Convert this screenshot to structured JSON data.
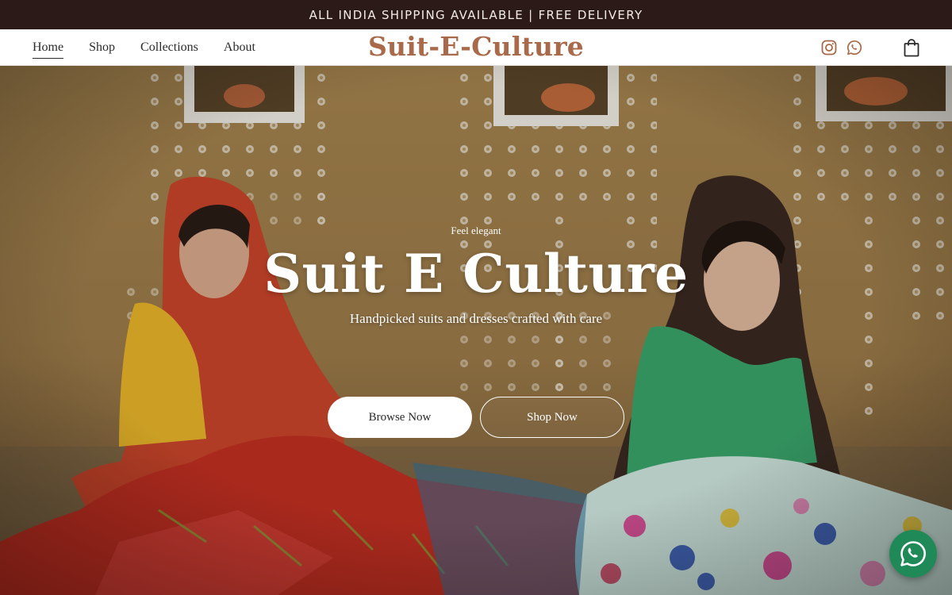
{
  "announcement": {
    "text": "ALL INDIA SHIPPING AVAILABLE | FREE DELIVERY"
  },
  "nav": {
    "items": [
      {
        "label": "Home",
        "active": true
      },
      {
        "label": "Shop"
      },
      {
        "label": "Collections"
      },
      {
        "label": "About"
      }
    ]
  },
  "brand": {
    "logo": "Suit-E-Culture",
    "color": "#a86a4a"
  },
  "header_icons": [
    "instagram-icon",
    "whatsapp-icon",
    "shopping-bag-icon"
  ],
  "hero": {
    "eyebrow": "Feel elegant",
    "title": "Suit E Culture",
    "subtitle": "Handpicked suits and dresses crafted with care",
    "primary_button": "Browse Now",
    "secondary_button": "Shop Now",
    "background_image": "artisan-statues-embroidery"
  },
  "floating_chat": {
    "icon": "whatsapp-icon",
    "color": "#1f8a57"
  },
  "colors": {
    "announcement_bg": "#2b1a17",
    "header_bg": "#ffffff",
    "text_dark": "#2b2b2b"
  }
}
